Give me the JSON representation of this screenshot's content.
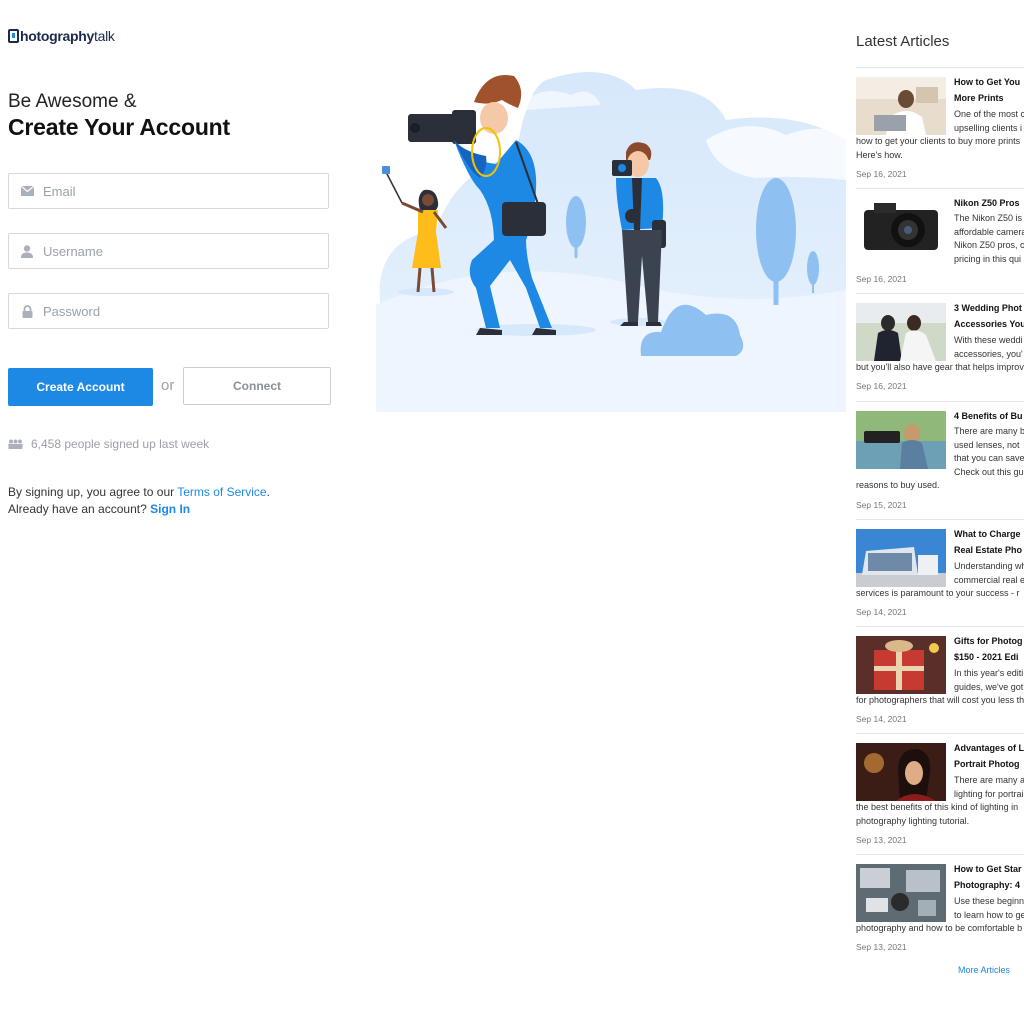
{
  "brand": {
    "logo_bold": "hotography",
    "logo_light": "talk"
  },
  "signup": {
    "heading_line1": "Be Awesome &",
    "heading_line2": "Create Your Account",
    "email_placeholder": "Email",
    "username_placeholder": "Username",
    "password_placeholder": "Password",
    "create_button": "Create Account",
    "or_text": "or",
    "connect_button": "Connect",
    "signup_count_text": "6,458 people signed up last week",
    "terms_prefix": "By signing up, you agree to our ",
    "terms_link": "Terms of Service",
    "terms_suffix": ".",
    "signin_prefix": "Already have an account? ",
    "signin_link": "Sign In"
  },
  "articles": {
    "title": "Latest Articles",
    "more_link": "More Articles",
    "items": [
      {
        "title_lines": [
          "How to Get You",
          "More Prints"
        ],
        "snippet_lines": [
          "One of the most c",
          "upselling clients i",
          "how to get your clients to buy more prints",
          "Here's how."
        ],
        "date": "Sep 16, 2021"
      },
      {
        "title_lines": [
          "Nikon Z50 Pros"
        ],
        "snippet_lines": [
          "The Nikon Z50 is",
          "affordable camera",
          "Nikon Z50 pros, c",
          "pricing in this qui"
        ],
        "date": "Sep 16, 2021"
      },
      {
        "title_lines": [
          "3 Wedding Phot",
          "Accessories You"
        ],
        "snippet_lines": [
          "With these weddi",
          "accessories, you'",
          "but you'll also have gear that helps improv"
        ],
        "date": "Sep 16, 2021"
      },
      {
        "title_lines": [
          "4 Benefits of Bu"
        ],
        "snippet_lines": [
          "There are many b",
          "used lenses, not",
          "that you can save",
          "Check out this gu",
          "reasons to buy used."
        ],
        "date": "Sep 15, 2021"
      },
      {
        "title_lines": [
          "What to Charge",
          "Real Estate Pho"
        ],
        "snippet_lines": [
          "Understanding wh",
          "commercial real e",
          "services is paramount to your success - r"
        ],
        "date": "Sep 14, 2021"
      },
      {
        "title_lines": [
          "Gifts for Photog",
          "$150 - 2021 Edi"
        ],
        "snippet_lines": [
          "In this year's editi",
          "guides, we've got",
          "for photographers that will cost you less th"
        ],
        "date": "Sep 14, 2021"
      },
      {
        "title_lines": [
          "Advantages of L",
          "Portrait Photog"
        ],
        "snippet_lines": [
          "There are many a",
          "lighting for portrai",
          "the best benefits of this kind of lighting in",
          "photography lighting tutorial."
        ],
        "date": "Sep 13, 2021"
      },
      {
        "title_lines": [
          "How to Get Star",
          "Photography: 4"
        ],
        "snippet_lines": [
          "Use these beginn",
          "to learn how to ge",
          "photography and how to be comfortable b"
        ],
        "date": "Sep 13, 2021"
      }
    ]
  },
  "colors": {
    "accent": "#1e88e5",
    "text_dark": "#111111",
    "muted": "#9aa1aa"
  }
}
